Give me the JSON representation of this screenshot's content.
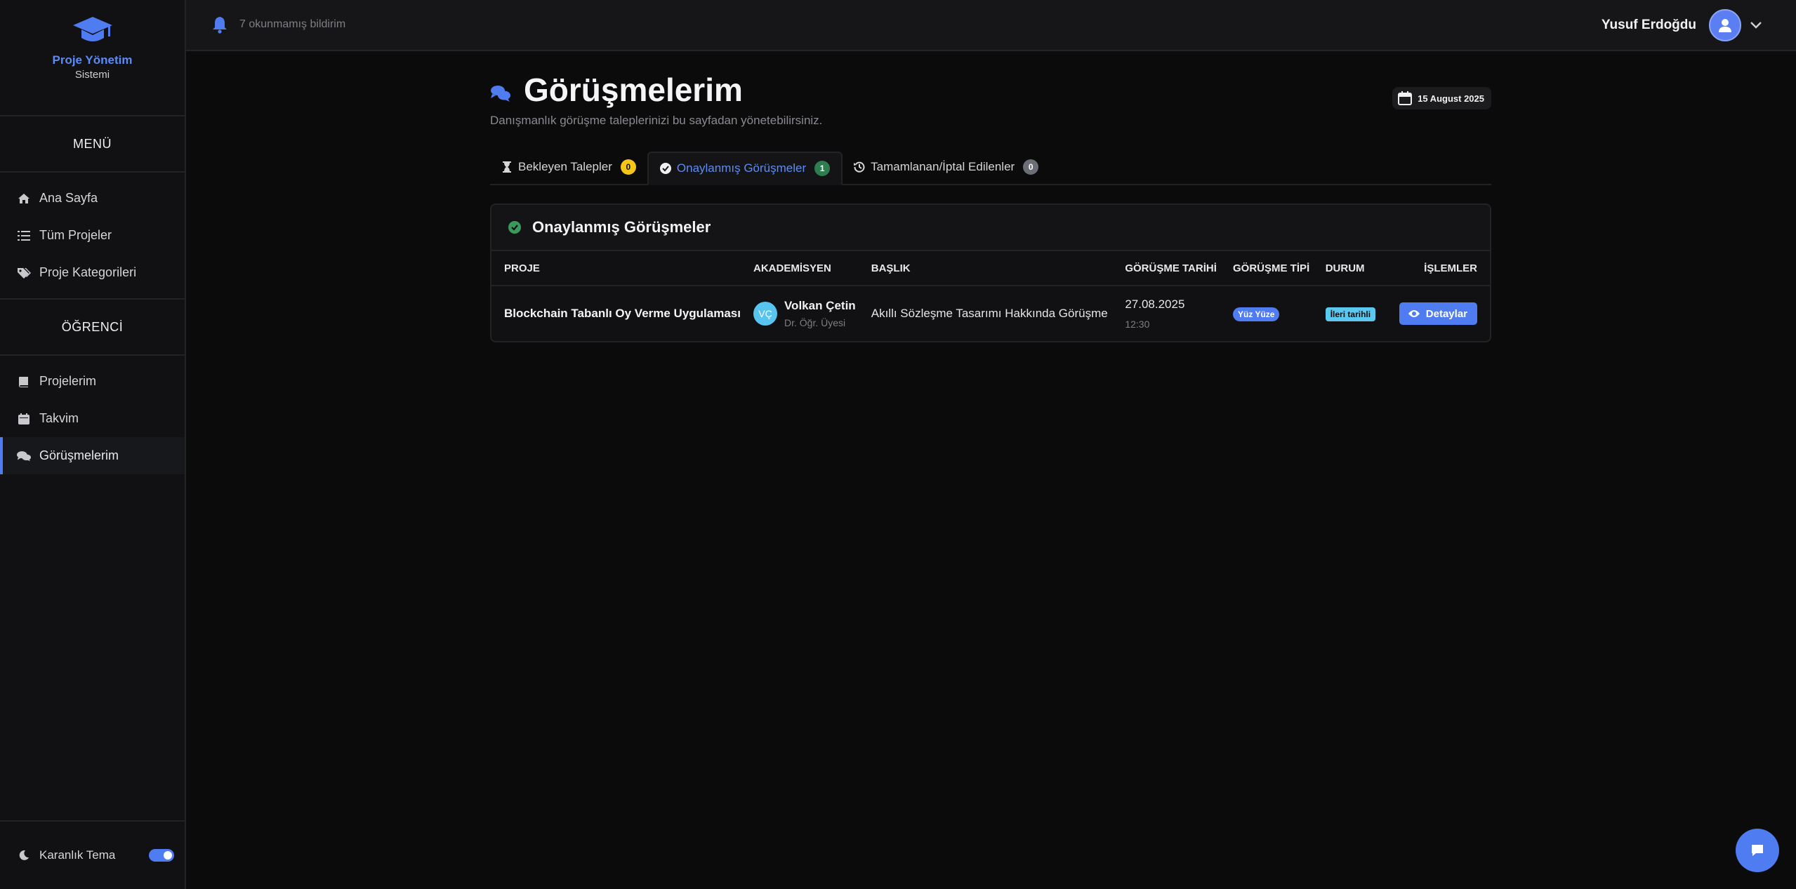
{
  "brand": {
    "line1": "Proje Yönetim",
    "line2": "Sistemi"
  },
  "sidebar": {
    "menu_title": "MENÜ",
    "menu_items": [
      {
        "label": "Ana Sayfa",
        "icon": "home-icon"
      },
      {
        "label": "Tüm Projeler",
        "icon": "list-icon"
      },
      {
        "label": "Proje Kategorileri",
        "icon": "tags-icon"
      }
    ],
    "student_title": "ÖĞRENCİ",
    "student_items": [
      {
        "label": "Projelerim",
        "icon": "book-icon"
      },
      {
        "label": "Takvim",
        "icon": "calendar-icon"
      },
      {
        "label": "Görüşmelerim",
        "icon": "comments-icon",
        "active": true
      }
    ],
    "theme": {
      "label": "Karanlık Tema",
      "enabled": true
    }
  },
  "topbar": {
    "notifications_text": "7 okunmamış bildirim",
    "user_name": "Yusuf Erdoğdu"
  },
  "page": {
    "title": "Görüşmelerim",
    "subtitle": "Danışmanlık görüşme taleplerinizi bu sayfadan yönetebilirsiniz.",
    "date": "15 August 2025"
  },
  "tabs": [
    {
      "label": "Bekleyen Talepler",
      "count": "0",
      "icon": "hourglass-icon",
      "badge_color": "#f5c518",
      "badge_text_color": "#111111"
    },
    {
      "label": "Onaylanmış Görüşmeler",
      "count": "1",
      "icon": "check-circle-icon",
      "badge_color": "#2e7d4f",
      "badge_text_color": "#ffffff",
      "active": true
    },
    {
      "label": "Tamamlanan/İptal Edilenler",
      "count": "0",
      "icon": "history-icon",
      "badge_color": "#6b6e75",
      "badge_text_color": "#ffffff"
    }
  ],
  "card": {
    "title": "Onaylanmış Görüşmeler",
    "columns": [
      "PROJE",
      "AKADEMİSYEN",
      "BAŞLIK",
      "GÖRÜŞME TARİHİ",
      "GÖRÜŞME TİPİ",
      "DURUM",
      "İŞLEMLER"
    ],
    "rows": [
      {
        "project": "Blockchain Tabanlı Oy Verme Uygulaması",
        "academic_initials": "VÇ",
        "academic_name": "Volkan Çetin",
        "academic_title": "Dr. Öğr. Üyesi",
        "subject": "Akıllı Sözleşme Tasarımı Hakkında Görüşme",
        "date": "27.08.2025",
        "time": "12:30",
        "type": "Yüz Yüze",
        "status": "İleri tarihli",
        "action": "Detaylar"
      }
    ]
  },
  "colors": {
    "accent": "#4f7cf0",
    "type_chip": "#4f7cf0",
    "status_chip": "#5bc8ef",
    "success": "#3a9a5c"
  }
}
